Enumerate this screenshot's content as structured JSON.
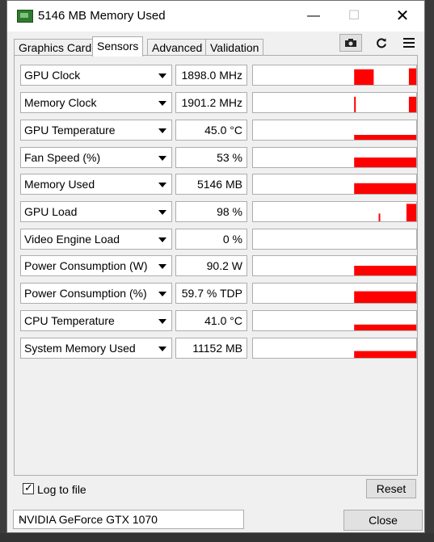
{
  "window": {
    "title": "5146 MB Memory Used",
    "controls": {
      "minimize": "—",
      "maximize": "☐",
      "close": "✕"
    }
  },
  "tabs": [
    {
      "label": "Graphics Card",
      "active": false
    },
    {
      "label": "Sensors",
      "active": true
    },
    {
      "label": "Advanced",
      "active": false
    },
    {
      "label": "Validation",
      "active": false
    }
  ],
  "toolbar": {
    "screenshot_icon": "camera-icon",
    "refresh_icon": "refresh-icon",
    "menu_icon": "hamburger-menu-icon"
  },
  "sensors": [
    {
      "label": "GPU Clock",
      "value": "1898.0 MHz",
      "graph": [
        [
          0.62,
          0.12,
          0.8
        ],
        [
          0.955,
          0.06,
          0.85
        ]
      ]
    },
    {
      "label": "Memory Clock",
      "value": "1901.2 MHz",
      "graph": [
        [
          0.62,
          0.01,
          0.8
        ],
        [
          0.955,
          0.045,
          0.8
        ]
      ]
    },
    {
      "label": "GPU Temperature",
      "value": "45.0 °C",
      "graph": [
        [
          0.62,
          0.38,
          0.25
        ]
      ]
    },
    {
      "label": "Fan Speed (%)",
      "value": "53 %",
      "graph": [
        [
          0.62,
          0.38,
          0.5
        ]
      ]
    },
    {
      "label": "Memory Used",
      "value": "5146 MB",
      "graph": [
        [
          0.62,
          0.38,
          0.55
        ]
      ]
    },
    {
      "label": "GPU Load",
      "value": "98 %",
      "graph": [
        [
          0.77,
          0.01,
          0.4
        ],
        [
          0.94,
          0.06,
          0.9
        ]
      ]
    },
    {
      "label": "Video Engine Load",
      "value": "0 %",
      "graph": []
    },
    {
      "label": "Power Consumption (W)",
      "value": "90.2 W",
      "graph": [
        [
          0.62,
          0.38,
          0.5
        ]
      ]
    },
    {
      "label": "Power Consumption (%)",
      "value": "59.7 % TDP",
      "graph": [
        [
          0.62,
          0.38,
          0.6
        ]
      ]
    },
    {
      "label": "CPU Temperature",
      "value": "41.0 °C",
      "graph": [
        [
          0.62,
          0.38,
          0.3
        ]
      ]
    },
    {
      "label": "System Memory Used",
      "value": "11152 MB",
      "graph": [
        [
          0.62,
          0.38,
          0.35
        ]
      ]
    }
  ],
  "footer": {
    "log_to_file_label": "Log to file",
    "log_to_file_checked": true,
    "reset_label": "Reset",
    "gpu_select_value": "NVIDIA GeForce GTX 1070",
    "close_label": "Close"
  },
  "colors": {
    "graph": "#ff0000",
    "window_bg": "#f0f0f0"
  }
}
